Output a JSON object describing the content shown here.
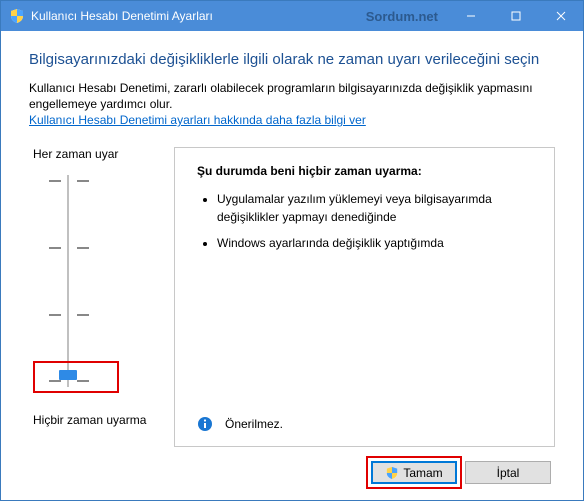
{
  "titlebar": {
    "title": "Kullanıcı Hesabı Denetimi Ayarları",
    "watermark": "Sordum.net"
  },
  "content": {
    "heading": "Bilgisayarınızdaki değişikliklerle ilgili olarak ne zaman uyarı verileceğini seçin",
    "description": "Kullanıcı Hesabı Denetimi, zararlı olabilecek programların bilgisayarınızda değişiklik yapmasını engellemeye yardımcı olur.",
    "link": "Kullanıcı Hesabı Denetimi ayarları hakkında daha fazla bilgi ver"
  },
  "slider": {
    "top_label": "Her zaman uyar",
    "bottom_label": "Hiçbir zaman uyarma"
  },
  "panel": {
    "heading": "Şu durumda beni hiçbir zaman uyarma:",
    "items": [
      "Uygulamalar yazılım yüklemeyi veya bilgisayarımda değişiklikler yapmayı denediğinde",
      "Windows ayarlarında değişiklik yaptığımda"
    ],
    "recommend": "Önerilmez."
  },
  "buttons": {
    "ok": "Tamam",
    "cancel": "İptal"
  }
}
